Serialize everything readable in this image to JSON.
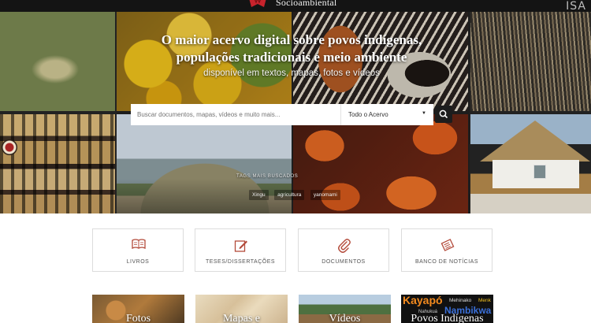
{
  "header": {
    "logo_text": "Socioambiental",
    "corner_badge": "ISA",
    "logo_icon": "isa-logo-icon"
  },
  "hero": {
    "title": "O maior acervo digital sobre povos indígenas, populações tradicionais e meio ambiente",
    "subtitle": "disponível em textos, mapas, fotos e vídeos"
  },
  "search": {
    "placeholder": "Buscar documentos, mapas, vídeos e muito mais...",
    "value": "",
    "scope_selected": "Todo o Acervo",
    "button_icon": "search-icon"
  },
  "tags": {
    "title": "TAGS MAIS BUSCADOS",
    "items": [
      "Xingu",
      "agricultura",
      "yanomami"
    ]
  },
  "categories": [
    {
      "label": "LIVROS",
      "icon": "book-icon"
    },
    {
      "label": "TESES/DISSERTAÇÕES",
      "icon": "pencil-square-icon"
    },
    {
      "label": "DOCUMENTOS",
      "icon": "paperclip-icon"
    },
    {
      "label": "BANCO DE NOTÍCIAS",
      "icon": "newspaper-icon"
    }
  ],
  "thumbnails": [
    {
      "label": "Fotos"
    },
    {
      "label": "Mapas e"
    },
    {
      "label": "Vídeos"
    },
    {
      "label": "Povos Indígenas",
      "overlay_words": [
        "Kayapó",
        "Mehinako",
        "Menk",
        "Nahukuá",
        "Nambikwa"
      ]
    }
  ],
  "colors": {
    "accent": "#c8232c",
    "topbar": "#141414",
    "search_button": "#1d1d1d",
    "card_border": "#dcdcdc",
    "card_icon": "#b34a3a"
  }
}
